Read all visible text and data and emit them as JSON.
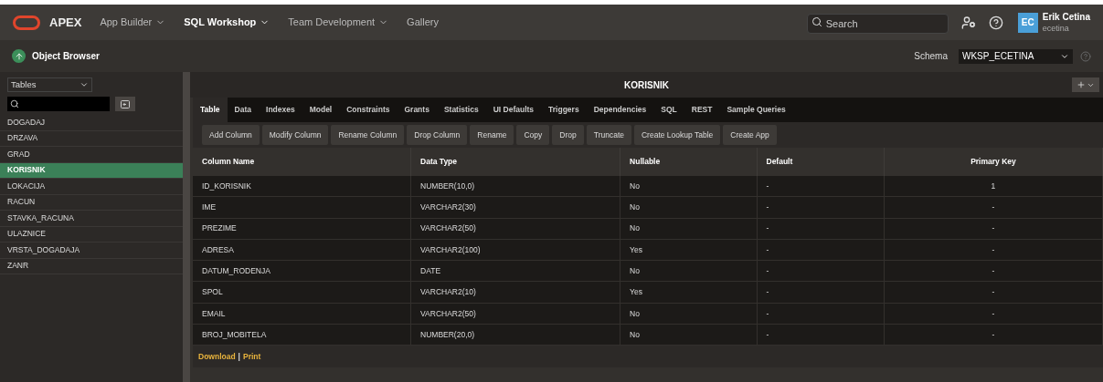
{
  "header": {
    "brand": "APEX",
    "nav": [
      {
        "label": "App Builder",
        "selected": false,
        "has_menu": true
      },
      {
        "label": "SQL Workshop",
        "selected": true,
        "has_menu": true
      },
      {
        "label": "Team Development",
        "selected": false,
        "has_menu": true
      },
      {
        "label": "Gallery",
        "selected": false,
        "has_menu": false
      }
    ],
    "search": {
      "placeholder": "Search"
    },
    "user": {
      "initials": "EC",
      "name": "Erik Cetina",
      "username": "ecetina"
    }
  },
  "subheader": {
    "title": "Object Browser",
    "schema_label": "Schema",
    "schema": "WKSP_ECETINA"
  },
  "sidebar": {
    "object_type": "Tables",
    "items": [
      {
        "label": "DOGADAJ",
        "selected": false
      },
      {
        "label": "DRZAVA",
        "selected": false
      },
      {
        "label": "GRAD",
        "selected": false
      },
      {
        "label": "KORISNIK",
        "selected": true
      },
      {
        "label": "LOKACIJA",
        "selected": false
      },
      {
        "label": "RACUN",
        "selected": false
      },
      {
        "label": "STAVKA_RACUNA",
        "selected": false
      },
      {
        "label": "ULAZNICE",
        "selected": false
      },
      {
        "label": "VRSTA_DOGADAJA",
        "selected": false
      },
      {
        "label": "ZANR",
        "selected": false
      }
    ]
  },
  "object_title": "KORISNIK",
  "tabs": [
    {
      "label": "Table",
      "selected": true
    },
    {
      "label": "Data",
      "selected": false
    },
    {
      "label": "Indexes",
      "selected": false
    },
    {
      "label": "Model",
      "selected": false
    },
    {
      "label": "Constraints",
      "selected": false
    },
    {
      "label": "Grants",
      "selected": false
    },
    {
      "label": "Statistics",
      "selected": false
    },
    {
      "label": "UI Defaults",
      "selected": false
    },
    {
      "label": "Triggers",
      "selected": false
    },
    {
      "label": "Dependencies",
      "selected": false
    },
    {
      "label": "SQL",
      "selected": false
    },
    {
      "label": "REST",
      "selected": false
    },
    {
      "label": "Sample Queries",
      "selected": false
    }
  ],
  "actions": [
    "Add Column",
    "Modify Column",
    "Rename Column",
    "Drop Column",
    "Rename",
    "Copy",
    "Drop",
    "Truncate",
    "Create Lookup Table",
    "Create App"
  ],
  "table": {
    "columns": [
      "Column Name",
      "Data Type",
      "Nullable",
      "Default",
      "Primary Key"
    ],
    "rows": [
      [
        "ID_KORISNIK",
        "NUMBER(10,0)",
        "No",
        "-",
        "1"
      ],
      [
        "IME",
        "VARCHAR2(30)",
        "No",
        "-",
        "-"
      ],
      [
        "PREZIME",
        "VARCHAR2(50)",
        "No",
        "-",
        "-"
      ],
      [
        "ADRESA",
        "VARCHAR2(100)",
        "Yes",
        "-",
        "-"
      ],
      [
        "DATUM_RODENJA",
        "DATE",
        "No",
        "-",
        "-"
      ],
      [
        "SPOL",
        "VARCHAR2(10)",
        "Yes",
        "-",
        "-"
      ],
      [
        "EMAIL",
        "VARCHAR2(50)",
        "No",
        "-",
        "-"
      ],
      [
        "BROJ_MOBITELA",
        "NUMBER(20,0)",
        "No",
        "-",
        "-"
      ]
    ]
  },
  "footer_links": [
    "Download",
    "|",
    "Print"
  ]
}
